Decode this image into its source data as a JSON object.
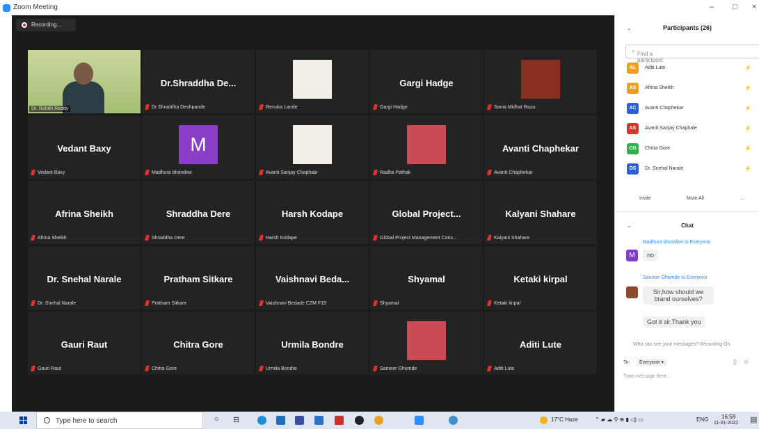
{
  "window": {
    "title": "Zoom Meeting",
    "controls": [
      "–",
      "□",
      "×"
    ]
  },
  "recording": {
    "label": "Recording..."
  },
  "tiles": [
    {
      "big": "",
      "name": "Dr. Rohith Reddy",
      "kind": "video",
      "active": true
    },
    {
      "big": "Dr.Shraddha De...",
      "name": "Dr.Shraddha Deshpande"
    },
    {
      "big": "",
      "name": "Renuka Lande",
      "kind": "photo"
    },
    {
      "big": "Gargi Hadge",
      "name": "Gargi Hadge"
    },
    {
      "big": "",
      "name": "Sania Midhat Raza",
      "kind": "photo"
    },
    {
      "big": "Vedant Baxy",
      "name": "Vedant Baxy"
    },
    {
      "big": "",
      "name": "Madhura bhondwe",
      "kind": "letter",
      "letter": "M"
    },
    {
      "big": "",
      "name": "Avanti Sanjay Chaphale",
      "kind": "photo"
    },
    {
      "big": "",
      "name": "Radha Pathak",
      "kind": "photo"
    },
    {
      "big": "Avanti Chaphekar",
      "name": "Avanti Chaphekar"
    },
    {
      "big": "Afrina Sheikh",
      "name": "Afrina Sheikh"
    },
    {
      "big": "Shraddha Dere",
      "name": "Shraddha Dere"
    },
    {
      "big": "Harsh Kodape",
      "name": "Harsh Kodape"
    },
    {
      "big": "Global Project...",
      "name": "Global Project Management Cons..."
    },
    {
      "big": "Kalyani Shahare",
      "name": "Kalyani Shahare"
    },
    {
      "big": "Dr. Snehal Narale",
      "name": "Dr. Snehal Narale"
    },
    {
      "big": "Pratham Sitkare",
      "name": "Pratham Sitkare"
    },
    {
      "big": "Vaishnavi  Beda...",
      "name": "Vaishnavi Bedade CZM F15"
    },
    {
      "big": "Shyamal",
      "name": "Shyamal"
    },
    {
      "big": "Ketaki kirpal",
      "name": "Ketaki kirpal"
    },
    {
      "big": "Gauri Raut",
      "name": "Gauri Raut"
    },
    {
      "big": "Chitra Gore",
      "name": "Chitra Gore"
    },
    {
      "big": "Urmila Bondre",
      "name": "Urmila Bondre"
    },
    {
      "big": "",
      "name": "Sameer Ghumde",
      "kind": "photo"
    },
    {
      "big": "Aditi Lute",
      "name": "Aditi Lute"
    }
  ],
  "participants": {
    "title": "Participants (26)",
    "search_placeholder": "Find a participant",
    "list": [
      {
        "initials": "AL",
        "name": "Aditi Lute",
        "color": "#f0a020"
      },
      {
        "initials": "AS",
        "name": "Afrina Sheikh",
        "color": "#f0a020"
      },
      {
        "initials": "AC",
        "name": "Avanti Chaphekar",
        "color": "#2b5fd9"
      },
      {
        "initials": "AS",
        "name": "Avanti Sanjay Chaphale",
        "color": "#d9342b"
      },
      {
        "initials": "CG",
        "name": "Chitra Gore",
        "color": "#2fb24c"
      },
      {
        "initials": "DS",
        "name": "Dr. Snehal Narale",
        "color": "#2b5fd9"
      }
    ],
    "invite": "Invite",
    "mute_all": "Mute All",
    "more": "..."
  },
  "chat": {
    "title": "Chat",
    "messages": [
      {
        "sender": "Madhura bhondwe to Everyone",
        "avatar": "M",
        "lines": [
          "no"
        ]
      },
      {
        "sender": "Sameer Ghumde to Everyone",
        "avatar": "",
        "lines": [
          "Sir,how should we brand ourselves?",
          "Got it sir.Thank you"
        ]
      }
    ],
    "who_can_see": "Who can see your messages? Recording On",
    "to_label": "To:",
    "to_value": "Everyone ▾",
    "input_placeholder": "Type message here..."
  },
  "taskbar": {
    "search": "Type here to search",
    "weather": "17°C Haze",
    "lang": "ENG",
    "time": "16:58",
    "date": "11-01-2022"
  }
}
